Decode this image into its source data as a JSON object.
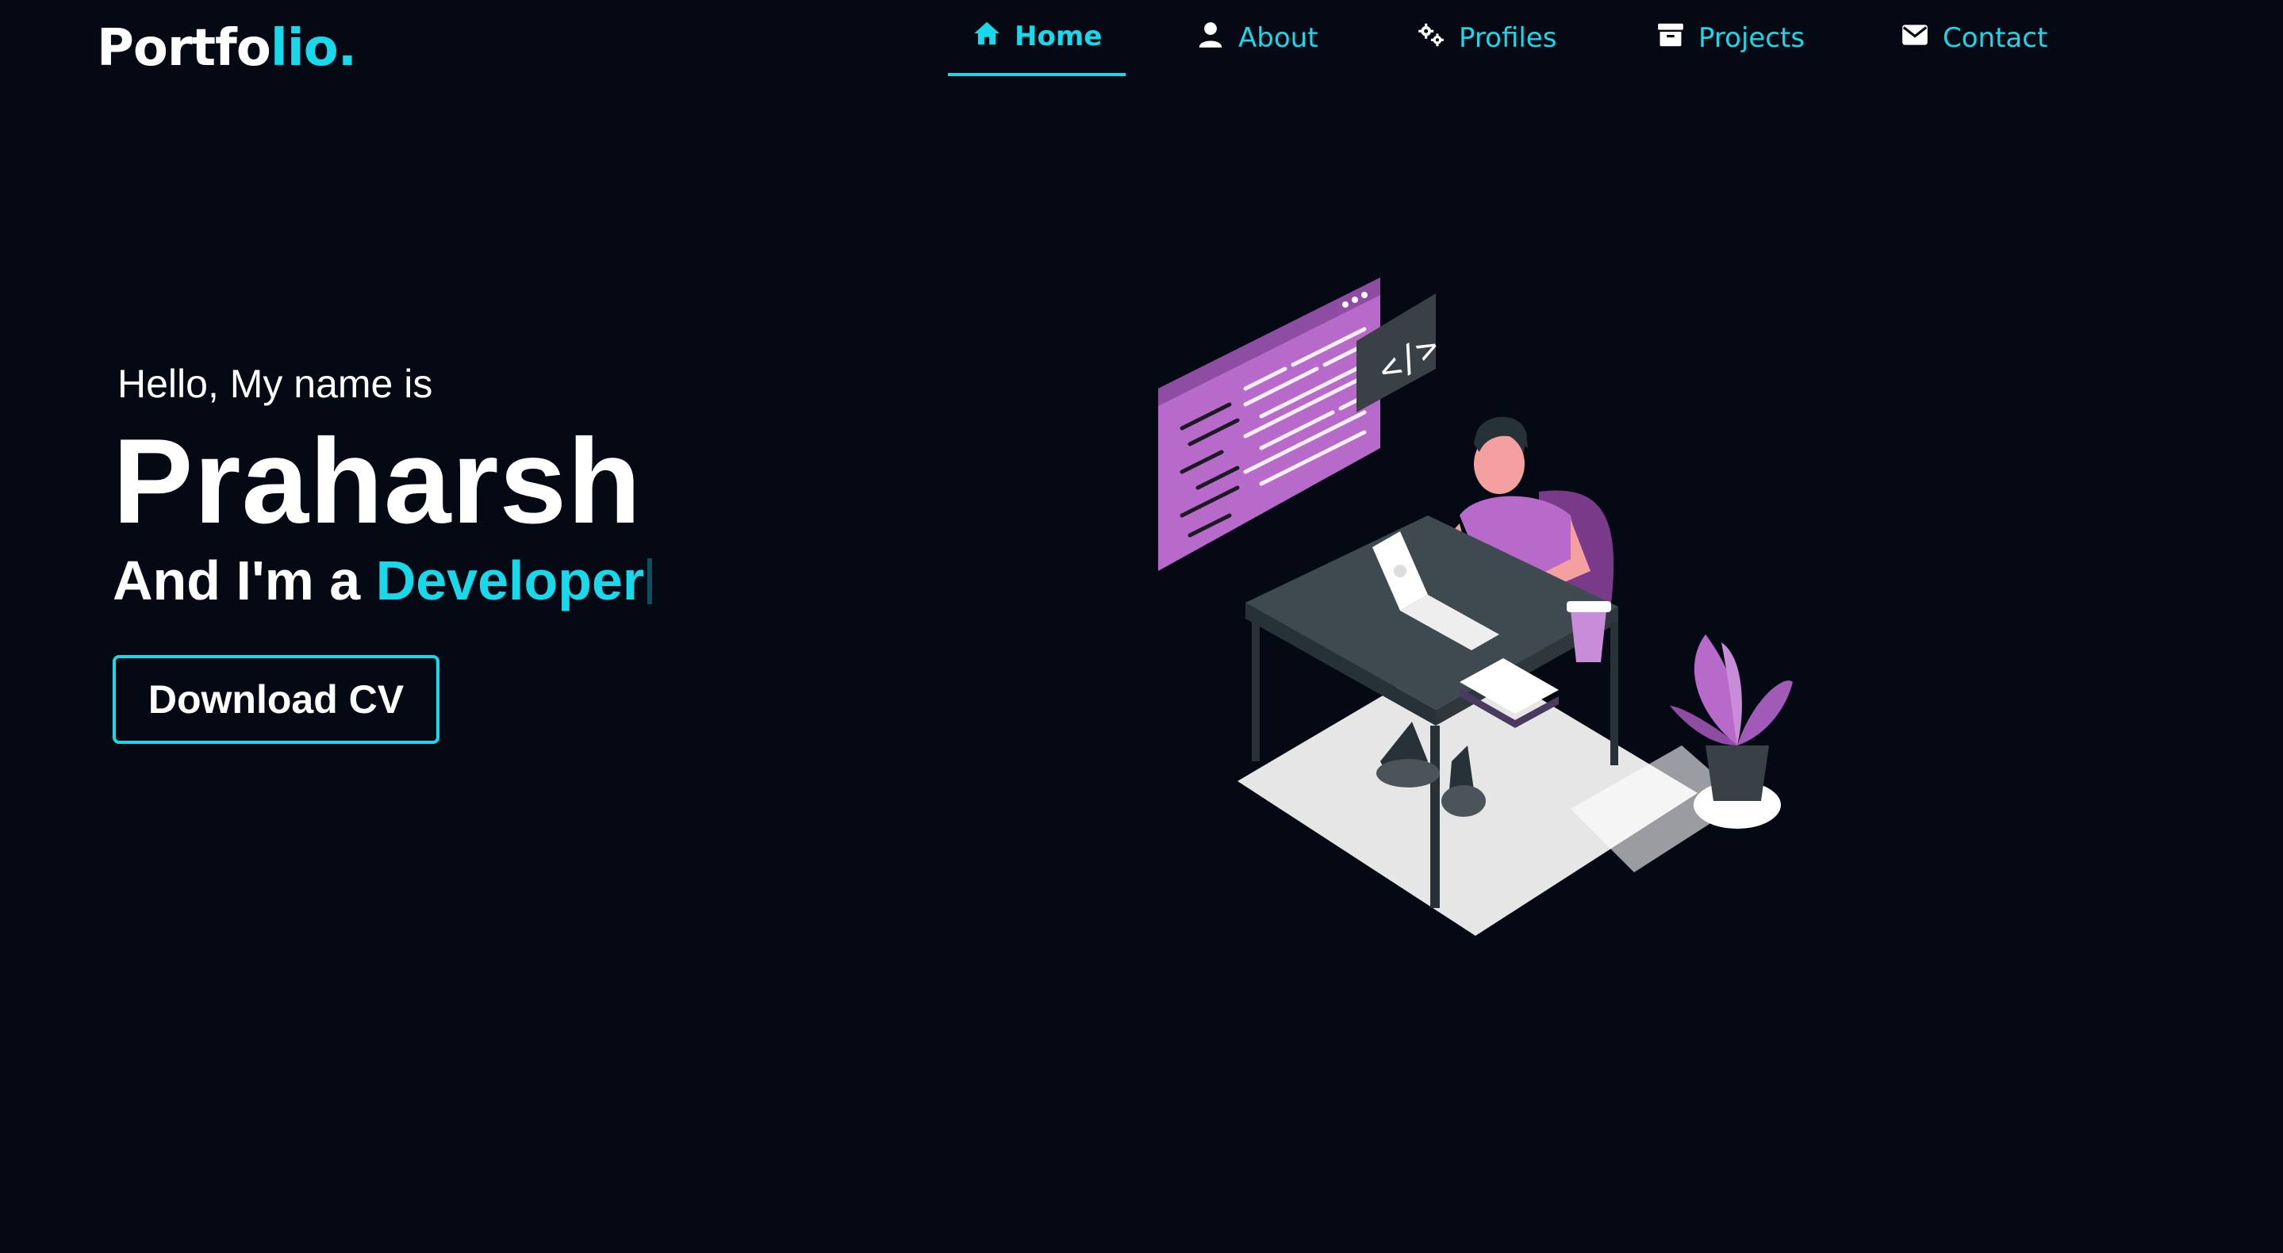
{
  "brand": {
    "logo_main": "Portfo",
    "logo_accent": "lio."
  },
  "nav": {
    "items": [
      {
        "label": "Home",
        "icon": "home-icon",
        "active": true
      },
      {
        "label": "About",
        "icon": "user-icon"
      },
      {
        "label": "Profiles",
        "icon": "gears-icon"
      },
      {
        "label": "Projects",
        "icon": "archive-icon"
      },
      {
        "label": "Contact",
        "icon": "envelope-icon"
      }
    ]
  },
  "hero": {
    "greeting": "Hello, My name is",
    "name": "Praharsh",
    "role_prefix": "And I'm a ",
    "role_highlight": "Developer",
    "cta_label": "Download CV",
    "illustration": "developer-at-desk-illustration"
  },
  "colors": {
    "background": "#050914",
    "accent": "#18d8ea",
    "text": "#ffffff",
    "purple": "#b76ac9"
  }
}
